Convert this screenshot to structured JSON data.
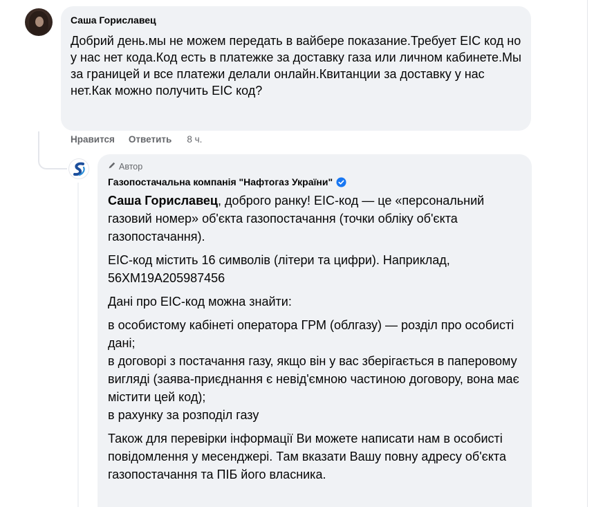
{
  "comment": {
    "author": "Саша Гориславец",
    "text": "Добрий день.мы не можем передать в вайбере показание.Требует ЕІС код но у нас нет кода.Код есть в платежке за доставку газа или личном кабинете.Мы за границей и все платежи делали онлайн.Квитанции за доставку у нас нет.Как можно получить ЕІС код?",
    "actions": {
      "like": "Нравится",
      "reply": "Ответить",
      "time": "8 ч."
    }
  },
  "reply": {
    "badge": "Автор",
    "author": "Газопостачальна компанія \"Нафтогаз України\"",
    "mention": "Саша Гориславец",
    "p1_rest": ", доброго ранку! ЕІС-код — це «персональний газовий номер» об'єкта газопостачання (точки обліку об'єкта газопостачання).",
    "p2": "ЕІС-код містить 16 символів (літери та цифри). Наприклад, 56XM19A205987456",
    "p3": "Дані про ЕІС-код можна знайти:",
    "p4_l1": "в особистому кабінеті оператора ГРМ (облгазу) — розділ про особисті дані;",
    "p4_l2": "в договорі з постачання газу, якщо він у вас зберігається в паперовому вигляді (заява-приєднання є невід'ємною частиною договору, вона має містити цей код);",
    "p4_l3": "в рахунку за розподіл газу",
    "p5": "Також для перевірки інформації Ви можете написати нам в особисті повідомлення у месенджері. Там вказати Вашу повну адресу об'єкта газопостачання та ПІБ його власника."
  },
  "colors": {
    "bubble": "#f0f2f5",
    "secondary_text": "#65676b",
    "verified": "#1877f2"
  },
  "icons": [
    "pencil-icon",
    "verified-badge-icon",
    "naftogaz-logo-icon"
  ]
}
